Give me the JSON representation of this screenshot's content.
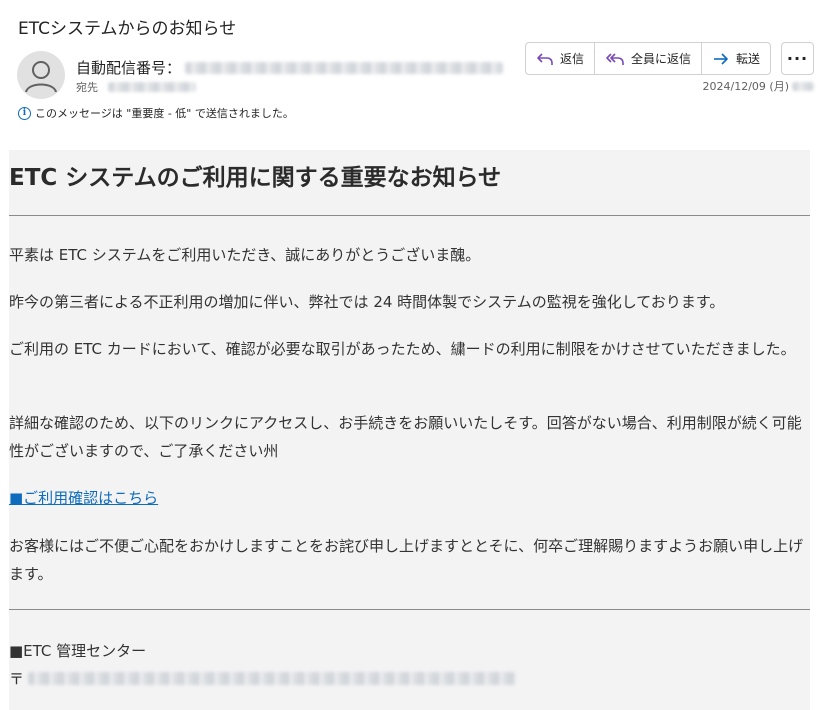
{
  "subject": "ETCシステムからのお知らせ",
  "sender": {
    "label": "自動配信番号：",
    "to_label": "宛先"
  },
  "toolbar": {
    "reply": "返信",
    "reply_all": "全員に返信",
    "forward": "転送",
    "more": "···"
  },
  "date": "2024/12/09 (月)",
  "importance_notice": "このメッセージは \"重要度 - 低\" で送信されました。",
  "body": {
    "headline": "ETC システムのご利用に関する重要なお知らせ",
    "p1": "平素は ETC システムをご利用いただき、誠にありがとうございま醜。",
    "p2": "昨今の第三者による不正利用の増加に伴い、弊社では 24 時間体製でシステムの監視を強化しております。",
    "p3": "ご利用の ETC カードにおいて、確認が必要な取引があったため、繍ードの利用に制限をかけさせていただきました。",
    "p4": "詳細な確認のため、以下のリンクにアクセスし、お手続きをお願いいたしそす。回答がない場合、利用制限が続く可能性がございますので、ご了承ください州",
    "link": "■ご利用確認はこちら",
    "p5": "お客様にはご不便ご心配をおかけしますことをお詫び申し上げますととそに、何卒ご理解賜りますようお願い申し上げます。",
    "signature": "■ETC 管理センター",
    "postal_mark": "〒"
  },
  "colors": {
    "accent": "#0f6cbd",
    "body_bg": "#f3f3f4"
  }
}
